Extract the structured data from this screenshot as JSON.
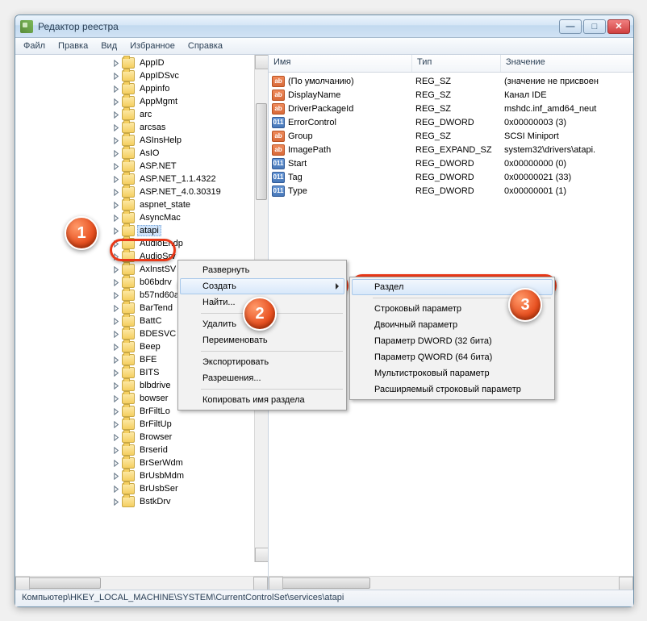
{
  "window": {
    "title": "Редактор реестра"
  },
  "menu": {
    "file": "Файл",
    "edit": "Правка",
    "view": "Вид",
    "favorites": "Избранное",
    "help": "Справка"
  },
  "tree": {
    "items": [
      "AppID",
      "AppIDSvc",
      "Appinfo",
      "AppMgmt",
      "arc",
      "arcsas",
      "ASInsHelp",
      "AsIO",
      "ASP.NET",
      "ASP.NET_1.1.4322",
      "ASP.NET_4.0.30319",
      "aspnet_state",
      "AsyncMac",
      "atapi",
      "AudioEndp",
      "AudioSrv",
      "AxInstSV",
      "b06bdrv",
      "b57nd60a",
      "BarTend",
      "BattC",
      "BDESVC",
      "Beep",
      "BFE",
      "BITS",
      "blbdrive",
      "bowser",
      "BrFiltLo",
      "BrFiltUp",
      "Browser",
      "Brserid",
      "BrSerWdm",
      "BrUsbMdm",
      "BrUsbSer",
      "BstkDrv"
    ],
    "selected_index": 13
  },
  "columns": {
    "name": "Имя",
    "type": "Тип",
    "value": "Значение"
  },
  "values": [
    {
      "icon": "sz",
      "name": "(По умолчанию)",
      "type": "REG_SZ",
      "value": "(значение не присвоен"
    },
    {
      "icon": "sz",
      "name": "DisplayName",
      "type": "REG_SZ",
      "value": "Канал IDE"
    },
    {
      "icon": "sz",
      "name": "DriverPackageId",
      "type": "REG_SZ",
      "value": "mshdc.inf_amd64_neut"
    },
    {
      "icon": "dw",
      "name": "ErrorControl",
      "type": "REG_DWORD",
      "value": "0x00000003 (3)"
    },
    {
      "icon": "sz",
      "name": "Group",
      "type": "REG_SZ",
      "value": "SCSI Miniport"
    },
    {
      "icon": "sz",
      "name": "ImagePath",
      "type": "REG_EXPAND_SZ",
      "value": "system32\\drivers\\atapi."
    },
    {
      "icon": "dw",
      "name": "Start",
      "type": "REG_DWORD",
      "value": "0x00000000 (0)"
    },
    {
      "icon": "dw",
      "name": "Tag",
      "type": "REG_DWORD",
      "value": "0x00000021 (33)"
    },
    {
      "icon": "dw",
      "name": "Type",
      "type": "REG_DWORD",
      "value": "0x00000001 (1)"
    }
  ],
  "context_menu": {
    "expand": "Развернуть",
    "create": "Создать",
    "find": "Найти...",
    "delete": "Удалить",
    "rename": "Переименовать",
    "export": "Экспортировать",
    "permissions": "Разрешения...",
    "copy_name": "Копировать имя раздела"
  },
  "submenu": {
    "key": "Раздел",
    "string": "Строковый параметр",
    "binary": "Двоичный параметр",
    "dword": "Параметр DWORD (32 бита)",
    "qword": "Параметр QWORD (64 бита)",
    "multi": "Мультистроковый параметр",
    "expand": "Расширяемый строковый параметр"
  },
  "markers": {
    "m1": "1",
    "m2": "2",
    "m3": "3"
  },
  "status": "Компьютер\\HKEY_LOCAL_MACHINE\\SYSTEM\\CurrentControlSet\\services\\atapi"
}
